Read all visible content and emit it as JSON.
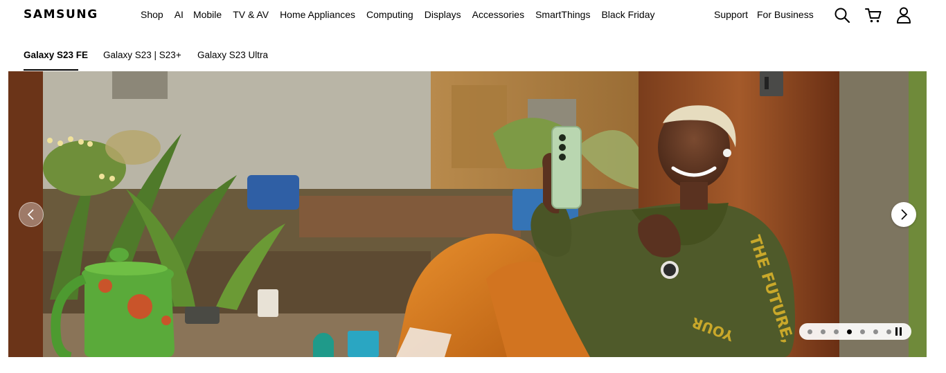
{
  "brand": {
    "logo_text": "SAMSUNG"
  },
  "nav": {
    "items": [
      "Shop",
      "AI",
      "Mobile",
      "TV & AV",
      "Home Appliances",
      "Computing",
      "Displays",
      "Accessories",
      "SmartThings",
      "Black Friday"
    ]
  },
  "utility": {
    "support": "Support",
    "business": "For Business"
  },
  "icons": {
    "search": "search-icon",
    "cart": "cart-icon",
    "account": "user-icon",
    "prev": "chevron-left-icon",
    "next": "chevron-right-icon",
    "pause": "pause-icon"
  },
  "subnav": {
    "tabs": [
      "Galaxy S23 FE",
      "Galaxy S23 | S23+",
      "Galaxy S23 Ultra"
    ],
    "active_index": 0
  },
  "hero": {
    "sweater_print": "THE FUTURE, YOUR",
    "slides_total": 7,
    "active_slide_index": 3
  },
  "colors": {
    "accent": "#000000",
    "sweater": "#4f5a2a",
    "pants": "#d9781f",
    "phone": "#b9d6b0"
  }
}
